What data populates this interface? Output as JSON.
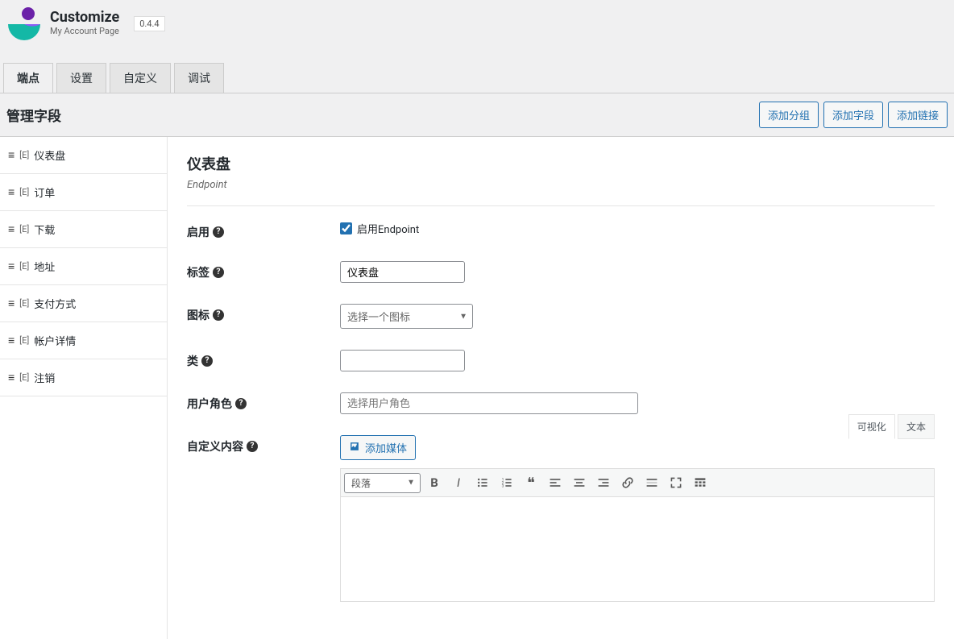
{
  "brand": {
    "title": "Customize",
    "subtitle": "My Account Page",
    "version": "0.4.4"
  },
  "main_tabs": {
    "items": [
      {
        "label": "端点",
        "active": true
      },
      {
        "label": "设置",
        "active": false
      },
      {
        "label": "自定义",
        "active": false
      },
      {
        "label": "调试",
        "active": false
      }
    ]
  },
  "panel": {
    "heading": "管理字段",
    "actions": [
      {
        "label": "添加分组"
      },
      {
        "label": "添加字段"
      },
      {
        "label": "添加链接"
      }
    ]
  },
  "sidebar": {
    "prefix": "[E]",
    "items": [
      {
        "label": "仪表盘"
      },
      {
        "label": "订单"
      },
      {
        "label": "下载"
      },
      {
        "label": "地址"
      },
      {
        "label": "支付方式"
      },
      {
        "label": "帐户详情"
      },
      {
        "label": "注销"
      }
    ]
  },
  "editor": {
    "title": "仪表盘",
    "subtitle": "Endpoint",
    "enable": {
      "label": "启用",
      "checkbox_label": "启用Endpoint",
      "checked": true
    },
    "tag": {
      "label": "标签",
      "value": "仪表盘"
    },
    "icon": {
      "label": "图标",
      "placeholder": "选择一个图标"
    },
    "class_field": {
      "label": "类",
      "value": ""
    },
    "user_role": {
      "label": "用户角色",
      "placeholder": "选择用户角色"
    },
    "custom_content": {
      "label": "自定义内容",
      "media_button": "添加媒体",
      "editor_tabs": {
        "visual": "可视化",
        "text": "文本"
      },
      "format_select": "段落"
    }
  }
}
